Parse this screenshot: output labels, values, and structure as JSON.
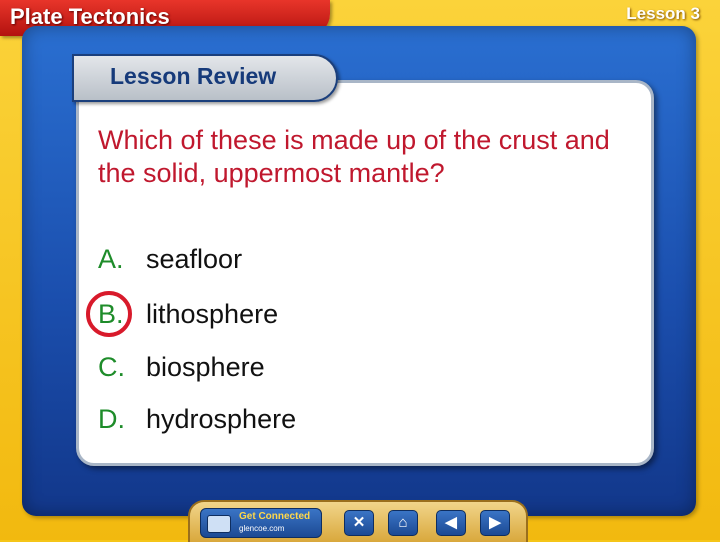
{
  "header": {
    "title": "Plate Tectonics",
    "lesson": "Lesson 3"
  },
  "banner": {
    "title": "Lesson Review"
  },
  "question": {
    "text": "Which of these is made up of the crust and the solid, uppermost mantle?",
    "answers": [
      {
        "letter": "A.",
        "text": "seafloor"
      },
      {
        "letter": "B.",
        "text": "lithosphere",
        "selected": true
      },
      {
        "letter": "C.",
        "text": "biosphere"
      },
      {
        "letter": "D.",
        "text": "hydrosphere"
      }
    ]
  },
  "nav": {
    "get_connected": "Get Connected",
    "url": "glencoe.com",
    "close_icon": "close-icon",
    "home_icon": "home-icon",
    "prev_icon": "prev-arrow-icon",
    "next_icon": "next-arrow-icon"
  },
  "colors": {
    "frame": "#f5c518",
    "title_tab": "#d22a22",
    "panel": "#1b4fae",
    "question": "#c0182e",
    "letter": "#1e8c2a",
    "highlight": "#d81a2b"
  }
}
